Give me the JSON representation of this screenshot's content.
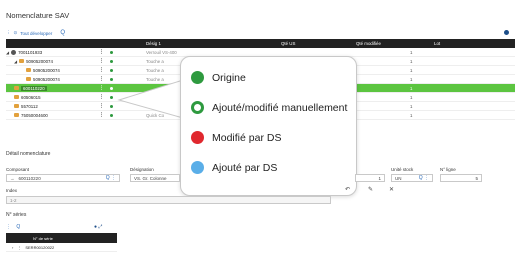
{
  "page": {
    "title": "Nomenclature SAV",
    "expand_all": "Tout développer"
  },
  "grid": {
    "headers": [
      "Désig 1",
      "Qté US",
      "Qté modifiée",
      "Lot"
    ],
    "rows": [
      {
        "code": "7001101933",
        "designation": "Verrouil VS-400",
        "qmod": "1",
        "type": "gear",
        "selected": false
      },
      {
        "code": "50905200074",
        "designation": "Touche a",
        "qmod": "1",
        "type": "folder",
        "selected": false
      },
      {
        "code": "50905200074",
        "designation": "Touche a",
        "qmod": "1",
        "type": "folder",
        "selected": false
      },
      {
        "code": "50905200074",
        "designation": "Touche a",
        "qmod": "1",
        "type": "folder",
        "selected": false
      },
      {
        "code": "600110220",
        "designation": "",
        "qmod": "1",
        "type": "folder",
        "selected": true
      },
      {
        "code": "60506015",
        "designation": "",
        "qmod": "1",
        "type": "folder",
        "selected": false
      },
      {
        "code": "5570112",
        "designation": "",
        "qmod": "1",
        "type": "folder",
        "selected": false
      },
      {
        "code": "75050004600",
        "designation": "Quick Co",
        "qmod": "1",
        "type": "folder",
        "selected": false
      }
    ]
  },
  "legend": {
    "items": [
      {
        "label": "Origine",
        "color": "#2e9a3f",
        "style": "filled"
      },
      {
        "label": "Ajouté/modifié manuellement",
        "color": "#2e9a3f",
        "style": "ring"
      },
      {
        "label": "Modifié par DS",
        "color": "#e0282e",
        "style": "filled"
      },
      {
        "label": "Ajouté par DS",
        "color": "#5aaee8",
        "style": "filled"
      }
    ]
  },
  "detail": {
    "title": "Détail nomenclature",
    "composant_label": "Composant",
    "composant_value": "600110220",
    "designation_label": "Désignation",
    "designation_value": "VS. Gr. Colonne",
    "qty_value": "1",
    "unite_label": "Unité stock",
    "unite_value": "UN",
    "ligne_label": "N° ligne",
    "ligne_value": "5",
    "index_label": "Index",
    "index_value": "1-2"
  },
  "series": {
    "title": "N° séries",
    "header": "N° de série",
    "rows": [
      {
        "value": "SERR00120022"
      }
    ]
  }
}
